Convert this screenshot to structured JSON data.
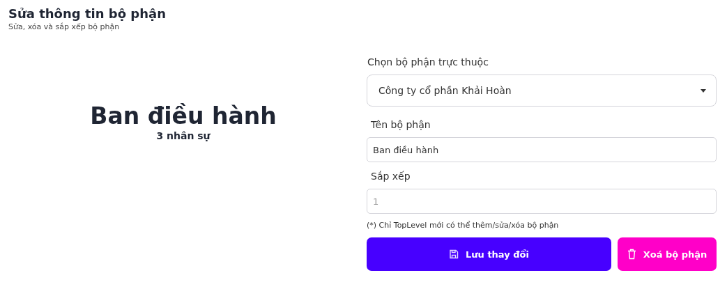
{
  "header": {
    "title": "Sửa thông tin bộ phận",
    "subtitle": "Sửa, xóa và sắp xếp bộ phận"
  },
  "summary": {
    "name": "Ban điều hành",
    "count": "3 nhân sự"
  },
  "form": {
    "fields": [
      {
        "kind": "select",
        "label": "Chọn bộ phận trực thuộc",
        "value": "Công ty cổ phần Khải Hoàn"
      },
      {
        "kind": "text",
        "label": "Tên bộ phận",
        "value": "Ban điều hành"
      },
      {
        "kind": "number",
        "label": "Sắp xếp",
        "placeholder": "1"
      }
    ],
    "note": "(*) Chỉ TopLevel mới có thể thêm/sửa/xóa bộ phận",
    "buttons": [
      {
        "kind": "save",
        "label": "Lưu thay đổi"
      },
      {
        "kind": "delete",
        "label": "Xoá bộ phận"
      }
    ]
  }
}
